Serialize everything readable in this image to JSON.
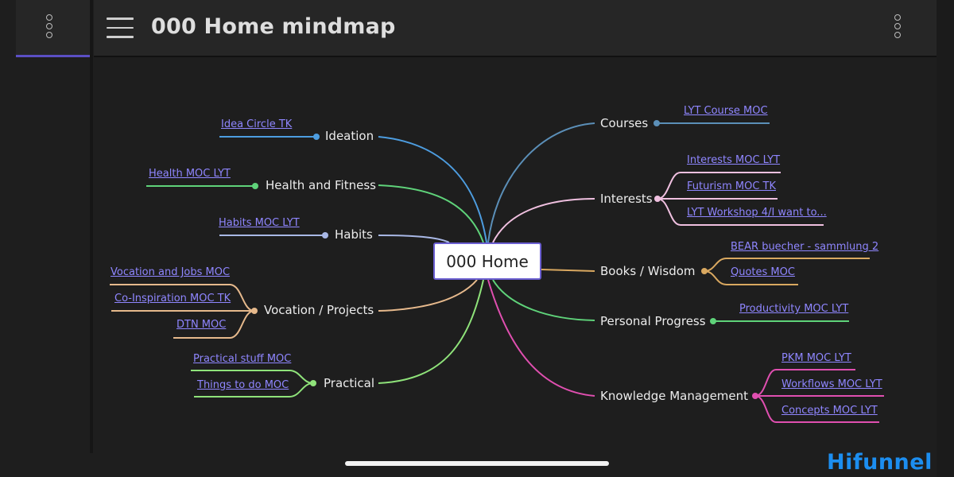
{
  "header": {
    "title": "000 Home mindmap"
  },
  "icons": {
    "left_menu": "more-vertical-icon",
    "hamburger": "hamburger-menu-icon",
    "right_menu": "more-vertical-icon"
  },
  "mindmap": {
    "root": "000 Home",
    "branches": {
      "ideation": {
        "label": "Ideation",
        "color": "#4d9de0",
        "links": [
          "Idea Circle TK"
        ]
      },
      "health": {
        "label": "Health and Fitness",
        "color": "#5fd37a",
        "links": [
          "Health MOC LYT"
        ]
      },
      "habits": {
        "label": "Habits",
        "color": "#a9b8e6",
        "links": [
          "Habits MOC LYT"
        ]
      },
      "vocation": {
        "label": "Vocation / Projects",
        "color": "#e6b98c",
        "links": [
          "Vocation and Jobs MOC",
          "Co-Inspiration MOC TK",
          "DTN MOC"
        ]
      },
      "practical": {
        "label": "Practical",
        "color": "#8fe37a",
        "links": [
          "Practical stuff MOC",
          "Things to do MOC"
        ]
      },
      "courses": {
        "label": "Courses",
        "color": "#5b8fb8",
        "links": [
          "LYT Course MOC"
        ]
      },
      "interests": {
        "label": "Interests",
        "color": "#f0c0e0",
        "links": [
          "Interests MOC LYT",
          "Futurism MOC TK",
          "LYT Workshop 4/I want to..."
        ]
      },
      "books": {
        "label": "Books / Wisdom",
        "color": "#d9a860",
        "links": [
          "BEAR buecher - sammlung 2",
          "Quotes MOC"
        ]
      },
      "progress": {
        "label": "Personal Progress",
        "color": "#5fd37a",
        "links": [
          "Productivity MOC LYT"
        ]
      },
      "knowledge": {
        "label": "Knowledge Management",
        "color": "#e04fb0",
        "links": [
          "PKM MOC LYT",
          "Workflows MOC LYT",
          "Concepts MOC LYT"
        ]
      }
    }
  },
  "watermark": {
    "text": "Hifunnel"
  }
}
